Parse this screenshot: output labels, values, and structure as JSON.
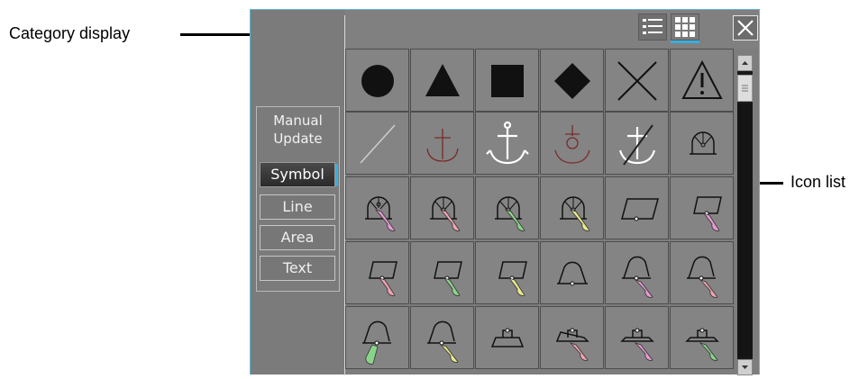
{
  "callouts": {
    "category_display": "Category display",
    "icon_list": "Icon list"
  },
  "toolbar": {
    "view_list_icon": "list-view-icon",
    "view_grid_icon": "grid-view-icon",
    "close_icon": "close-icon"
  },
  "category": {
    "header_line1": "Manual",
    "header_line2": "Update",
    "items": [
      "Symbol",
      "Line",
      "Area",
      "Text"
    ],
    "selected": "Symbol"
  },
  "colors": {
    "accent": "#38b0e0",
    "fill_dark": "#111111",
    "anchor_red": "#7a2a2a",
    "pink": "#e69ad2",
    "green": "#8ad48a",
    "yellow": "#eaea8a",
    "salmon": "#f0a2b0"
  },
  "icons": [
    "circle-icon",
    "triangle-icon",
    "square-icon",
    "diamond-icon",
    "cross-icon",
    "warning-icon",
    "diagonal-line-icon",
    "anchor-red-icon",
    "anchor-white-icon",
    "anchor-ring-red-icon",
    "anchor-prohibited-icon",
    "dome-icon",
    "sector-dome-pink-icon",
    "sector-dome-salmon-icon",
    "sector-dome-green-icon",
    "sector-dome-yellow-icon",
    "parallelogram-icon",
    "sector-para-pink-icon",
    "sector-para-salmon-icon",
    "sector-para-green-icon",
    "sector-para-yellow-icon",
    "beacon-icon",
    "sector-beacon-pink-icon",
    "sector-beacon-salmon-icon",
    "sector-beacon-green-icon",
    "sector-beacon-yellow-icon",
    "buoy-icon",
    "sector-buoy-salmon-icon",
    "sector-buoy-pink-icon",
    "sector-buoy-green-icon"
  ]
}
